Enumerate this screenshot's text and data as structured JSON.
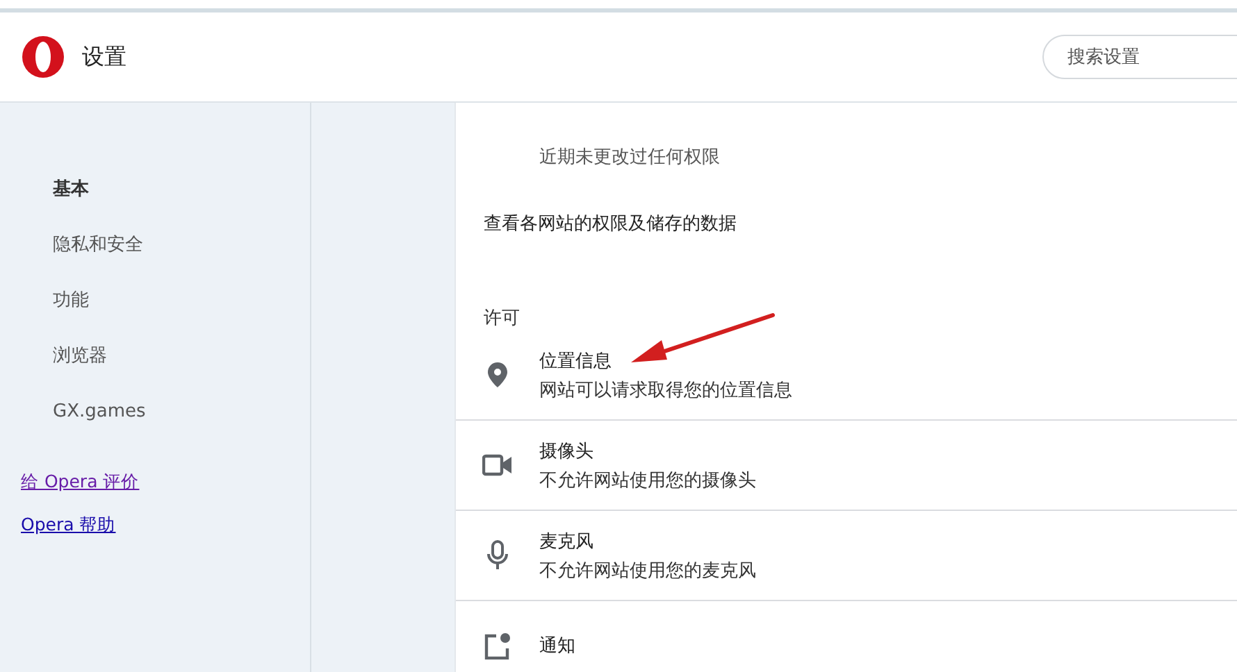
{
  "header": {
    "title": "设置",
    "search": {
      "placeholder": "搜索设置"
    }
  },
  "sidebar": {
    "items": [
      {
        "label": "基本",
        "selected": true
      },
      {
        "label": "隐私和安全",
        "selected": false
      },
      {
        "label": "功能",
        "selected": false
      },
      {
        "label": "浏览器",
        "selected": false
      },
      {
        "label": "GX.games",
        "selected": false
      }
    ],
    "links": [
      {
        "label": "给 Opera 评价",
        "visited": true
      },
      {
        "label": "Opera 帮助",
        "visited": false
      }
    ]
  },
  "content": {
    "recent_note": "近期未更改过任何权限",
    "site_data_link": "查看各网站的权限及储存的数据",
    "section_title": "许可",
    "permissions": [
      {
        "kind": "location",
        "title": "位置信息",
        "subtitle": "网站可以请求取得您的位置信息"
      },
      {
        "kind": "camera",
        "title": "摄像头",
        "subtitle": "不允许网站使用您的摄像头"
      },
      {
        "kind": "microphone",
        "title": "麦克风",
        "subtitle": "不允许网站使用您的麦克风"
      },
      {
        "kind": "notifications",
        "title": "通知"
      }
    ]
  }
}
